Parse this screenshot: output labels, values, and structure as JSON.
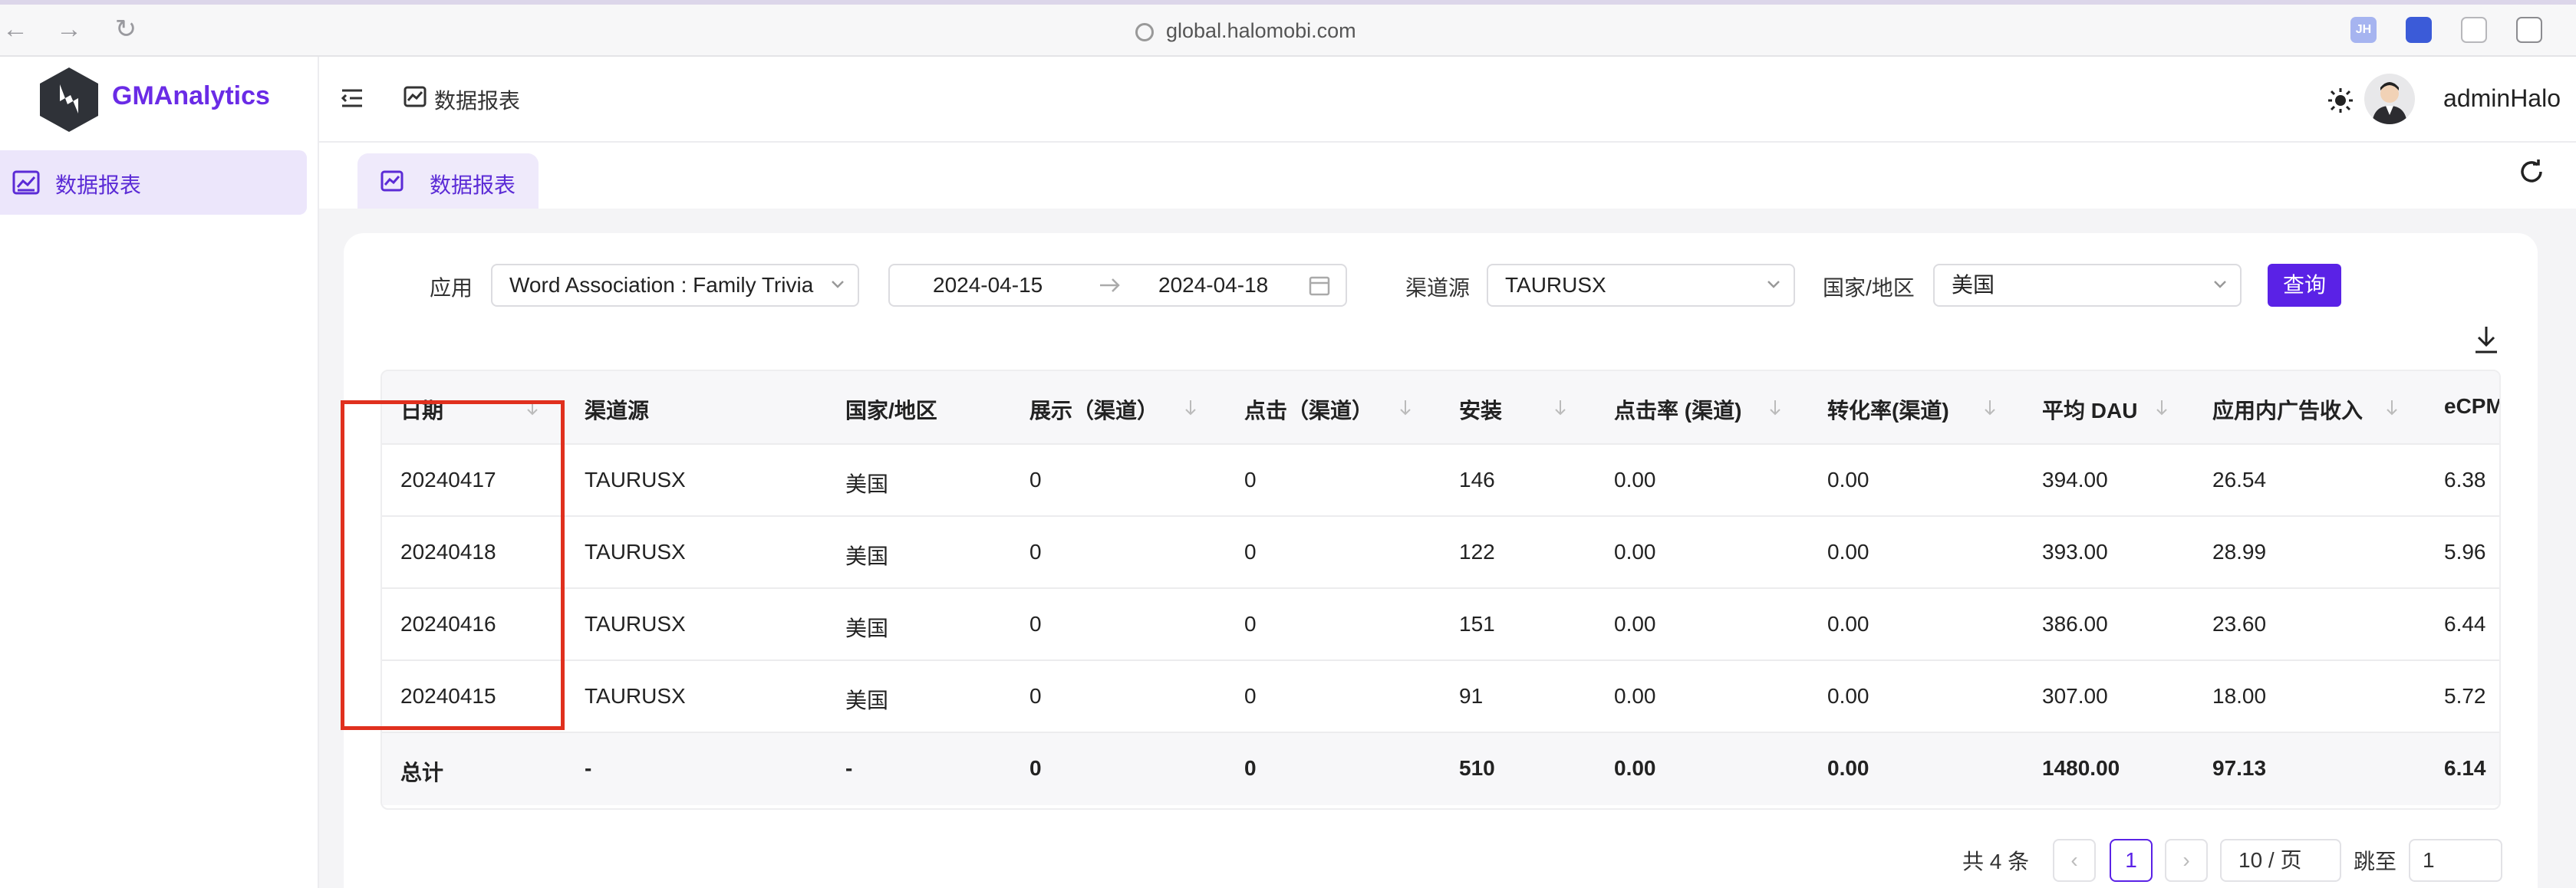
{
  "browser": {
    "url": "global.halomobi.com",
    "extensions": [
      "JH"
    ]
  },
  "sidebar": {
    "brand": "GMAnalytics",
    "items": [
      {
        "label": "数据报表"
      }
    ]
  },
  "header": {
    "breadcrumb": "数据报表",
    "username": "adminHalo"
  },
  "tabs": [
    {
      "label": "数据报表"
    }
  ],
  "filters": {
    "app_label": "应用",
    "app_value": "Word Association : Family Trivia",
    "date_start": "2024-04-15",
    "date_end": "2024-04-18",
    "channel_label": "渠道源",
    "channel_value": "TAURUSX",
    "country_label": "国家/地区",
    "country_value": "美国",
    "query_button": "查询"
  },
  "table": {
    "headers": [
      "日期",
      "渠道源",
      "国家/地区",
      "展示（渠道）",
      "点击（渠道）",
      "安装",
      "点击率 (渠道)",
      "转化率(渠道)",
      "平均 DAU",
      "应用内广告收入",
      "eCPM"
    ],
    "rows": [
      [
        "20240417",
        "TAURUSX",
        "美国",
        "0",
        "0",
        "146",
        "0.00",
        "0.00",
        "394.00",
        "26.54",
        "6.38"
      ],
      [
        "20240418",
        "TAURUSX",
        "美国",
        "0",
        "0",
        "122",
        "0.00",
        "0.00",
        "393.00",
        "28.99",
        "5.96"
      ],
      [
        "20240416",
        "TAURUSX",
        "美国",
        "0",
        "0",
        "151",
        "0.00",
        "0.00",
        "386.00",
        "23.60",
        "6.44"
      ],
      [
        "20240415",
        "TAURUSX",
        "美国",
        "0",
        "0",
        "91",
        "0.00",
        "0.00",
        "307.00",
        "18.00",
        "5.72"
      ]
    ],
    "total": [
      "总计",
      "-",
      "-",
      "0",
      "0",
      "510",
      "0.00",
      "0.00",
      "1480.00",
      "97.13",
      "6.14"
    ]
  },
  "pagination": {
    "total_text": "共 4 条",
    "current_page": "1",
    "prev": "‹",
    "next": "›",
    "page_size": "10 / 页",
    "jump_label": "跳至",
    "jump_value": "1"
  },
  "colors": {
    "accent": "#5a22e6",
    "highlight": "#e0301e"
  }
}
